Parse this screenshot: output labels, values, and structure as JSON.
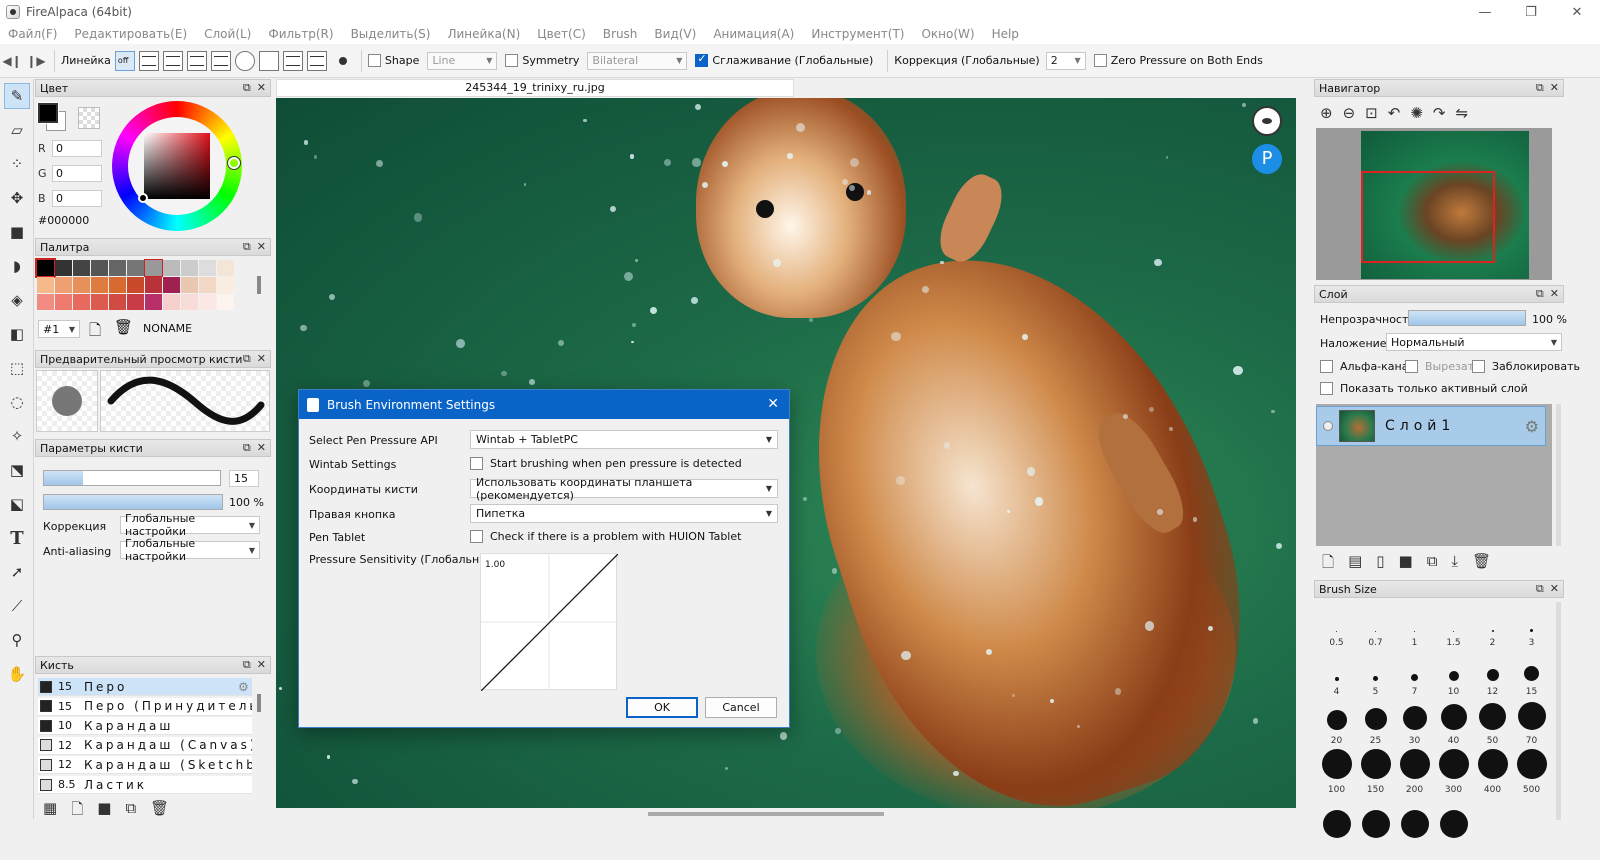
{
  "window": {
    "title": "FireAlpaca (64bit)",
    "buttons": [
      "—",
      "❐",
      "✕"
    ]
  },
  "menu": [
    "Файл(F)",
    "Редактировать(E)",
    "Слой(L)",
    "Фильтр(R)",
    "Выделить(S)",
    "Линейка(N)",
    "Цвет(C)",
    "Brush",
    "Вид(V)",
    "Анимация(A)",
    "Инструмент(T)",
    "Окно(W)",
    "Help"
  ],
  "toolbar": {
    "ruler_label": "Линейка",
    "off_label": "off",
    "shape_label": "Shape",
    "shape_value": "Line",
    "symmetry_label": "Symmetry",
    "symmetry_value": "Bilateral",
    "smoothing_label": "Сглаживание (Глобальные)",
    "correction_label": "Коррекция (Глобальные)",
    "correction_value": "2",
    "zero_pressure_label": "Zero Pressure on Both Ends"
  },
  "color_panel": {
    "title": "Цвет",
    "r_label": "R",
    "r_value": "0",
    "g_label": "G",
    "g_value": "0",
    "b_label": "B",
    "b_value": "0",
    "hex": "#000000"
  },
  "palette_panel": {
    "title": "Палитра",
    "index": "#1",
    "name": "NONAME",
    "colors": [
      "#000000",
      "#333333",
      "#444444",
      "#555555",
      "#666666",
      "#777777",
      "#999999",
      "#bbbbbb",
      "#cccccc",
      "#dddddd",
      "#f3e6d6",
      "#f5b98a",
      "#f0a070",
      "#e8905a",
      "#e07b40",
      "#d86a30",
      "#c84a2a",
      "#b8323a",
      "#a02050",
      "#e8c8b0",
      "#f2d8c4",
      "#faeee2",
      "#f28c82",
      "#ee7a6e",
      "#e86a5e",
      "#dc5a4e",
      "#d04c42",
      "#c83c48",
      "#b8306a",
      "#f6d0cc",
      "#f7dcd8",
      "#fbe8e4",
      "#fdf4f0"
    ]
  },
  "brush_preview": {
    "title": "Предварительный просмотр кисти"
  },
  "brush_params": {
    "title": "Параметры кисти",
    "size_value": "15",
    "size_fraction": 0.22,
    "opacity_value": "100 %",
    "opacity_fraction": 1.0,
    "correction_label": "Коррекция",
    "correction_value": "Глобальные настройки",
    "aa_label": "Anti-aliasing",
    "aa_value": "Глобальные настройки"
  },
  "brush_list": {
    "title": "Кисть",
    "items": [
      {
        "size": "15",
        "name": "Перо",
        "selected": true
      },
      {
        "size": "15",
        "name": "Перо (Принудительное)",
        "selected": false
      },
      {
        "size": "10",
        "name": "Карандаш",
        "selected": false
      },
      {
        "size": "12",
        "name": "Карандаш (Canvas)",
        "selected": false
      },
      {
        "size": "12",
        "name": "Карандаш (Sketchbook)",
        "selected": false
      },
      {
        "size": "8.5",
        "name": "Ластик",
        "selected": false
      }
    ]
  },
  "document": {
    "tab": "245344_19_trinixy_ru.jpg"
  },
  "dialog": {
    "title": "Brush Environment Settings",
    "pen_api_label": "Select Pen Pressure API",
    "pen_api_value": "Wintab + TabletPC",
    "wintab_label": "Wintab Settings",
    "wintab_check": "Start brushing when pen pressure is detected",
    "coords_label": "Координаты кисти",
    "coords_value": "Использовать координаты планшета (рекомендуется)",
    "right_btn_label": "Правая кнопка",
    "right_btn_value": "Пипетка",
    "pen_tablet_label": "Pen Tablet",
    "pen_tablet_check": "Check if there is a problem with HUION Tablet",
    "sensitivity_label": "Pressure Sensitivity (Глобальные)",
    "curve_value": "1.00",
    "ok": "OK",
    "cancel": "Cancel"
  },
  "navigator": {
    "title": "Навигатор"
  },
  "layer_panel": {
    "title": "Слой",
    "opacity_label": "Непрозрачность",
    "opacity_value": "100 %",
    "blend_label": "Наложение",
    "blend_value": "Нормальный",
    "alpha_label": "Альфа-кана.",
    "clip_label": "Вырезать",
    "lock_label": "Заблокировать",
    "show_active_label": "Показать только активный слой",
    "layer_name": "Слой1"
  },
  "brush_size": {
    "title": "Brush Size",
    "sizes": [
      "0.5",
      "0.7",
      "1",
      "1.5",
      "2",
      "3",
      "4",
      "5",
      "7",
      "10",
      "12",
      "15",
      "20",
      "25",
      "30",
      "40",
      "50",
      "70",
      "100",
      "150",
      "200",
      "300",
      "400",
      "500",
      "",
      "",
      "",
      ""
    ]
  }
}
